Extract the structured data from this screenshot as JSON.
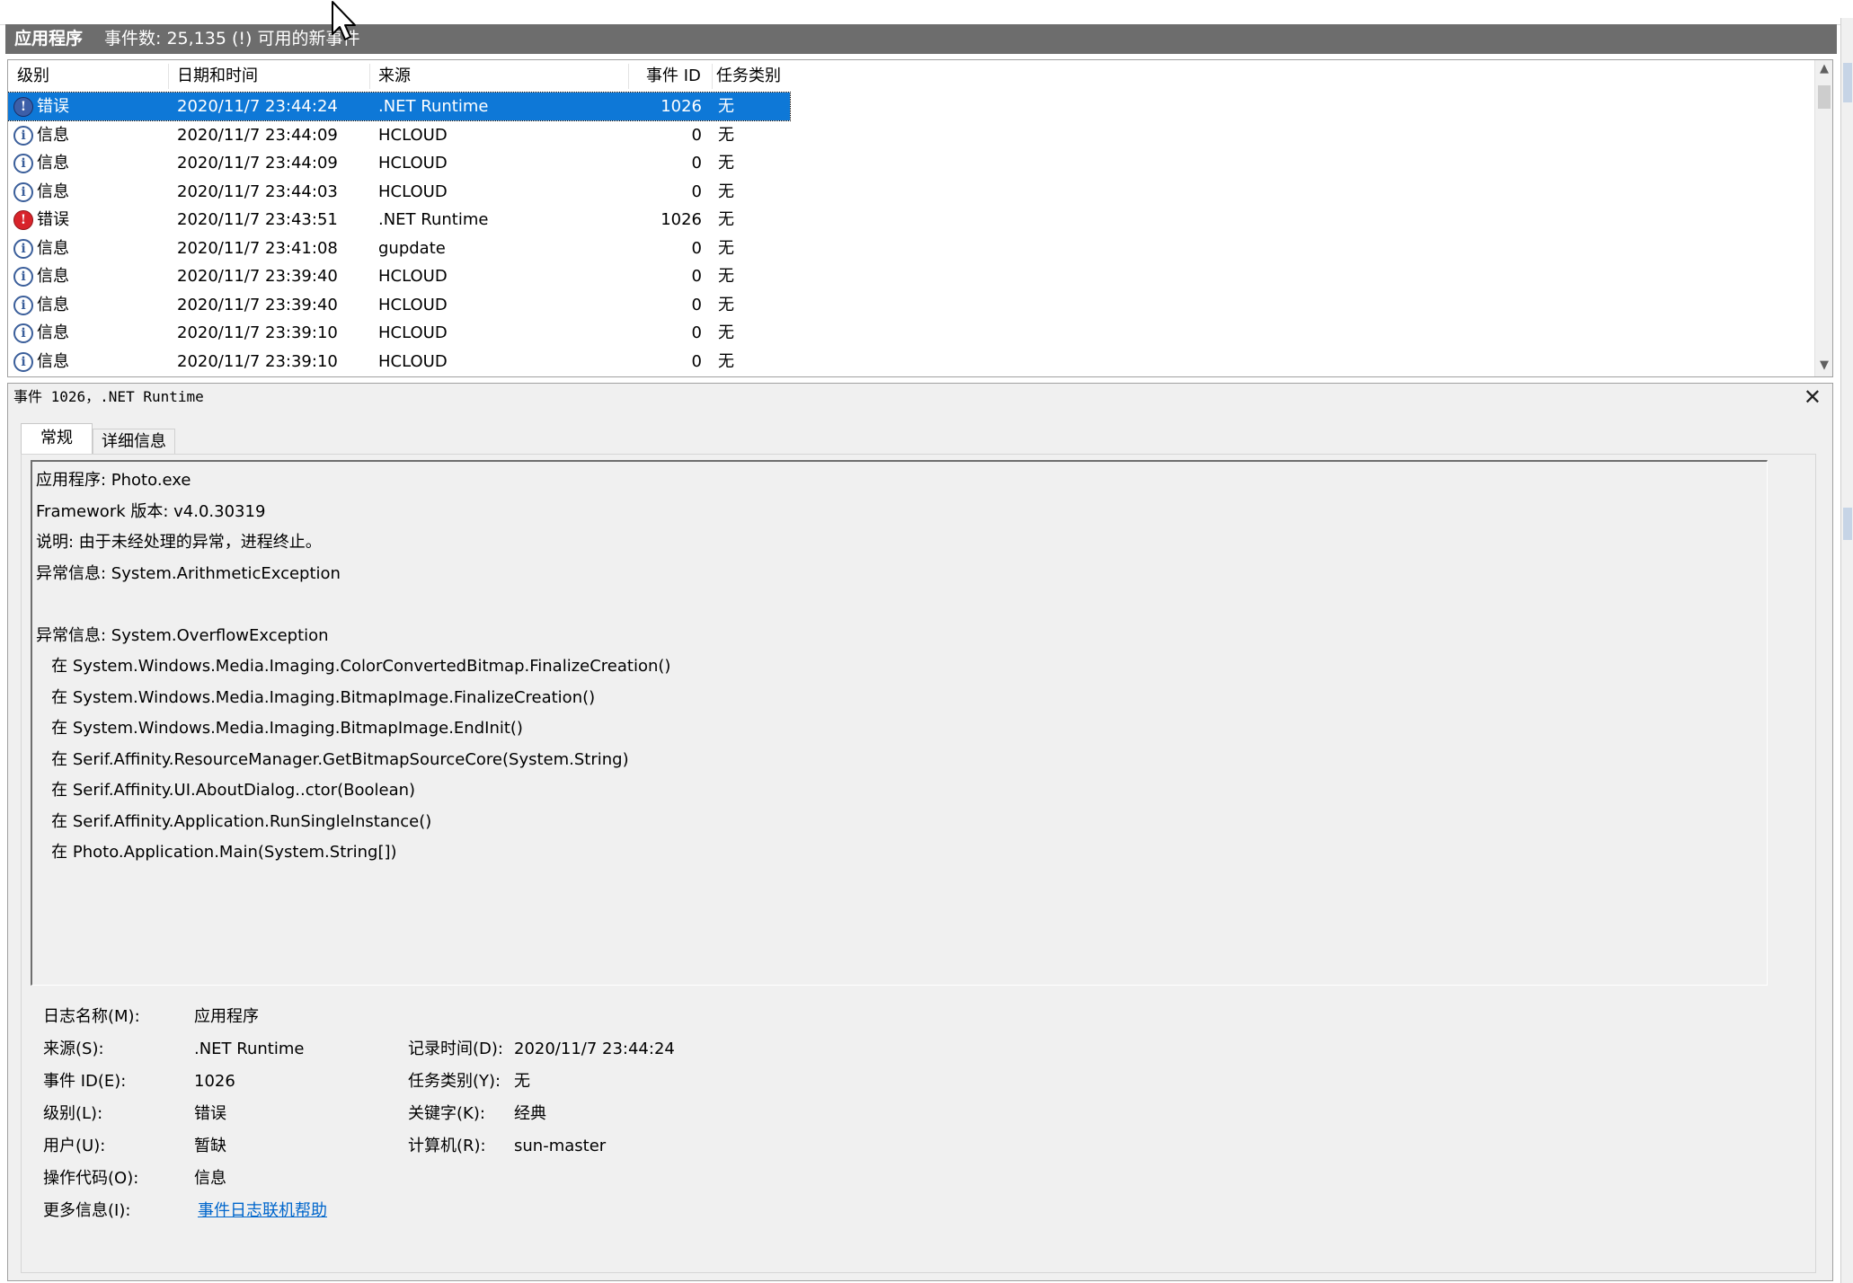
{
  "window": {
    "title": "应用程序",
    "subtitle": "事件数: 25,135 (!) 可用的新事件"
  },
  "columns": {
    "level": "级别",
    "datetime": "日期和时间",
    "source": "来源",
    "event_id": "事件 ID",
    "task_category": "任务类别"
  },
  "events": [
    {
      "level": "错误",
      "icon": "error-icon",
      "datetime": "2020/11/7 23:44:24",
      "source": ".NET Runtime",
      "event_id": "1026",
      "task": "无",
      "selected": true
    },
    {
      "level": "信息",
      "icon": "info-icon",
      "datetime": "2020/11/7 23:44:09",
      "source": "HCLOUD",
      "event_id": "0",
      "task": "无"
    },
    {
      "level": "信息",
      "icon": "info-icon",
      "datetime": "2020/11/7 23:44:09",
      "source": "HCLOUD",
      "event_id": "0",
      "task": "无"
    },
    {
      "level": "信息",
      "icon": "info-icon",
      "datetime": "2020/11/7 23:44:03",
      "source": "HCLOUD",
      "event_id": "0",
      "task": "无"
    },
    {
      "level": "错误",
      "icon": "error-icon",
      "datetime": "2020/11/7 23:43:51",
      "source": ".NET Runtime",
      "event_id": "1026",
      "task": "无"
    },
    {
      "level": "信息",
      "icon": "info-icon",
      "datetime": "2020/11/7 23:41:08",
      "source": "gupdate",
      "event_id": "0",
      "task": "无"
    },
    {
      "level": "信息",
      "icon": "info-icon",
      "datetime": "2020/11/7 23:39:40",
      "source": "HCLOUD",
      "event_id": "0",
      "task": "无"
    },
    {
      "level": "信息",
      "icon": "info-icon",
      "datetime": "2020/11/7 23:39:40",
      "source": "HCLOUD",
      "event_id": "0",
      "task": "无"
    },
    {
      "level": "信息",
      "icon": "info-icon",
      "datetime": "2020/11/7 23:39:10",
      "source": "HCLOUD",
      "event_id": "0",
      "task": "无"
    },
    {
      "level": "信息",
      "icon": "info-icon",
      "datetime": "2020/11/7 23:39:10",
      "source": "HCLOUD",
      "event_id": "0",
      "task": "无"
    }
  ],
  "detail": {
    "title": "事件 1026，.NET Runtime",
    "close_glyph": "✕",
    "tabs": [
      "常规",
      "详细信息"
    ],
    "description_lines": [
      "应用程序: Photo.exe",
      "Framework 版本: v4.0.30319",
      "说明: 由于未经处理的异常，进程终止。",
      "异常信息: System.ArithmeticException",
      "",
      "异常信息: System.OverflowException",
      "   在 System.Windows.Media.Imaging.ColorConvertedBitmap.FinalizeCreation()",
      "   在 System.Windows.Media.Imaging.BitmapImage.FinalizeCreation()",
      "   在 System.Windows.Media.Imaging.BitmapImage.EndInit()",
      "   在 Serif.Affinity.ResourceManager.GetBitmapSourceCore(System.String)",
      "   在 Serif.Affinity.UI.AboutDialog..ctor(Boolean)",
      "   在 Serif.Affinity.Application.RunSingleInstance()",
      "   在 Photo.Application.Main(System.String[])"
    ],
    "fields": {
      "log_name_label": "日志名称(M):",
      "log_name": "应用程序",
      "source_label": "来源(S):",
      "source": ".NET Runtime",
      "logged_label": "记录时间(D):",
      "logged": "2020/11/7 23:44:24",
      "event_id_label": "事件 ID(E):",
      "event_id": "1026",
      "task_label": "任务类别(Y):",
      "task": "无",
      "level_label": "级别(L):",
      "level": "错误",
      "keywords_label": "关键字(K):",
      "keywords": "经典",
      "user_label": "用户(U):",
      "user": "暂缺",
      "computer_label": "计算机(R):",
      "computer": "sun-master",
      "opcode_label": "操作代码(O):",
      "opcode": "信息",
      "more_info_label": "更多信息(I):",
      "more_info_link": "事件日志联机帮助"
    }
  },
  "scrollbar": {
    "up": "▲",
    "down": "▼"
  }
}
